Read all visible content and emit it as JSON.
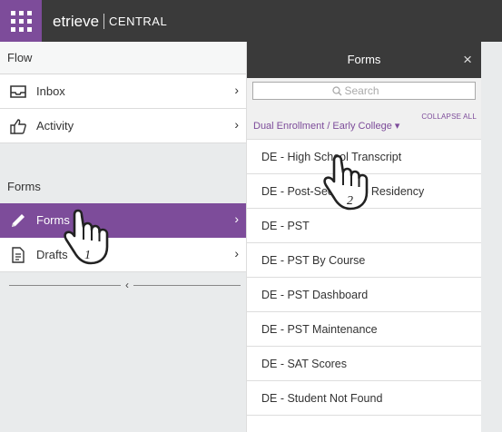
{
  "header": {
    "brand_main": "etrieve",
    "brand_sub": "CENTRAL"
  },
  "left_panel": {
    "flow_heading": "Flow",
    "flow_items": [
      {
        "label": "Inbox",
        "icon": "inbox-tray-icon"
      },
      {
        "label": "Activity",
        "icon": "thumbs-up-icon"
      }
    ],
    "forms_heading": "Forms",
    "forms_items": [
      {
        "label": "Forms",
        "icon": "pencil-icon",
        "active": true
      },
      {
        "label": "Drafts",
        "icon": "document-icon",
        "active": false
      }
    ],
    "collapse_glyph": "‹",
    "chevron_glyph": "›"
  },
  "forms_panel": {
    "title": "Forms",
    "close_glyph": "×",
    "search_placeholder": "Search",
    "category": "Dual Enrollment / Early College ▾",
    "collapse_all": "COLLAPSE ALL",
    "items": [
      "DE - High School Transcript",
      "DE - Post-Secondary Residency",
      "DE - PST",
      "DE - PST By Course",
      "DE - PST Dashboard",
      "DE - PST Maintenance",
      "DE - SAT Scores",
      "DE - Student Not Found"
    ]
  },
  "annotations": {
    "step_1": "1",
    "step_2": "2"
  },
  "colors": {
    "accent": "#7d4c9a",
    "topbar": "#3a3a3a",
    "panel_bg": "#e9ebec"
  }
}
